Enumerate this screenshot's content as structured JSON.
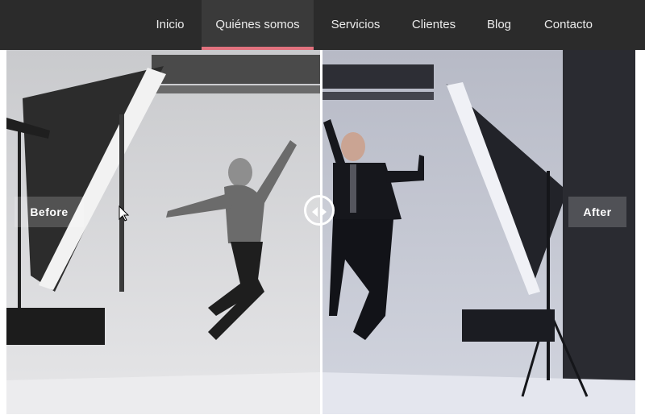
{
  "nav": {
    "items": [
      {
        "label": "Inicio"
      },
      {
        "label": "Quiénes somos"
      },
      {
        "label": "Servicios"
      },
      {
        "label": "Clientes"
      },
      {
        "label": "Blog"
      },
      {
        "label": "Contacto"
      }
    ],
    "active_label": "Quiénes somos",
    "accent": "#e2727e"
  },
  "comparison": {
    "before_label": "Before",
    "after_label": "After",
    "handle_icon": "left-right-arrows-icon"
  }
}
